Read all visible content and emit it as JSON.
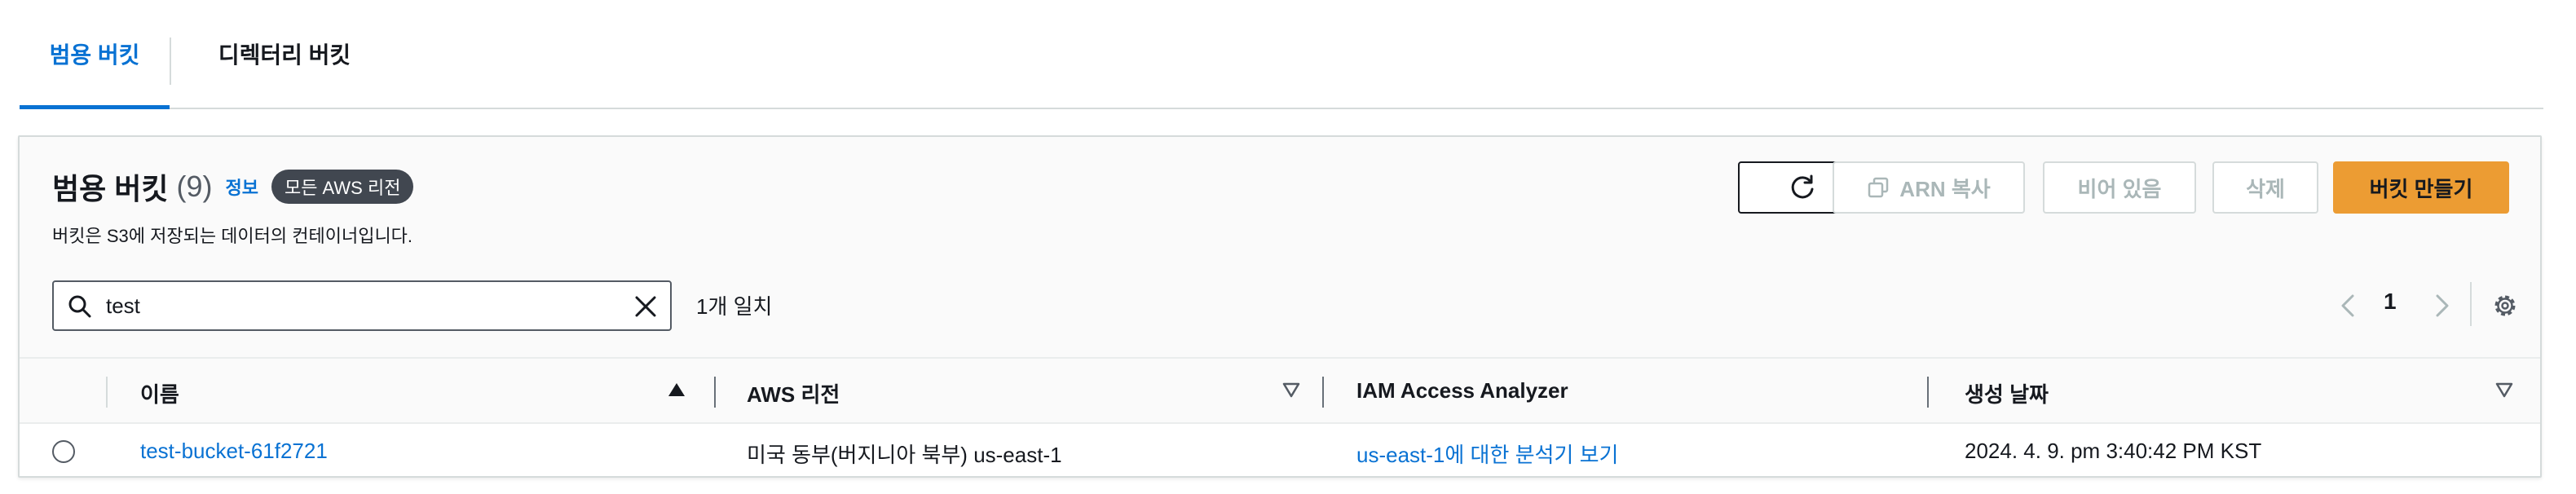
{
  "tabs": [
    {
      "label": "범용 버킷",
      "active": true
    },
    {
      "label": "디렉터리 버킷",
      "active": false
    }
  ],
  "panel": {
    "title": "범용 버킷",
    "count": "(9)",
    "info_link": "정보",
    "region_badge": "모든 AWS 리전",
    "description": "버킷은 S3에 저장되는 데이터의 컨테이너입니다."
  },
  "actions": {
    "refresh_icon": "refresh-icon",
    "arn_copy_label": "ARN 복사",
    "arn_copy_icon": "copy-icon",
    "empty_label": "비어 있음",
    "delete_label": "삭제",
    "create_label": "버킷 만들기"
  },
  "search": {
    "value": "test",
    "match_count": "1개 일치"
  },
  "pagination": {
    "current_page": "1"
  },
  "table": {
    "columns": [
      "이름",
      "AWS 리전",
      "IAM Access Analyzer",
      "생성 날짜"
    ],
    "rows": [
      {
        "name": "test-bucket-61f2721",
        "region": "미국 동부(버지니아 북부) us-east-1",
        "access_analyzer": "us-east-1에 대한 분석기 보기",
        "created": "2024. 4. 9. pm 3:40:42 PM KST"
      }
    ]
  },
  "colors": {
    "accent_blue": "#0972d3",
    "primary_button": "#ec9c33",
    "badge_bg": "#414750",
    "border": "#d5dbdb"
  }
}
